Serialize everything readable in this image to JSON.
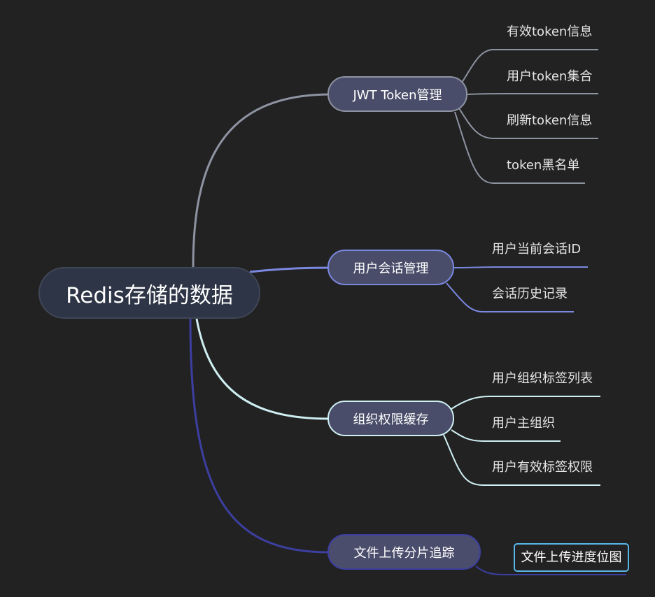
{
  "root": {
    "label": "Redis存储的数据"
  },
  "branches": [
    {
      "label": "JWT Token管理",
      "color": "#8e93a2",
      "children": [
        "有效token信息",
        "用户token集合",
        "刷新token信息",
        "token黑名单"
      ]
    },
    {
      "label": "用户会话管理",
      "color": "#7a88e0",
      "children": [
        "用户当前会话ID",
        "会话历史记录"
      ]
    },
    {
      "label": "组织权限缓存",
      "color": "#cfeff2",
      "children": [
        "用户组织标签列表",
        "用户主组织",
        "用户有效标签权限"
      ]
    },
    {
      "label": "文件上传分片追踪",
      "color": "#3c3fa0",
      "children": [
        "文件上传进度位图"
      ]
    }
  ],
  "colors": {
    "background": "#222222",
    "root_fill": "#2e3546",
    "branch_fill": "#4a4d69",
    "boxed_leaf_border": "#58b7e8"
  }
}
